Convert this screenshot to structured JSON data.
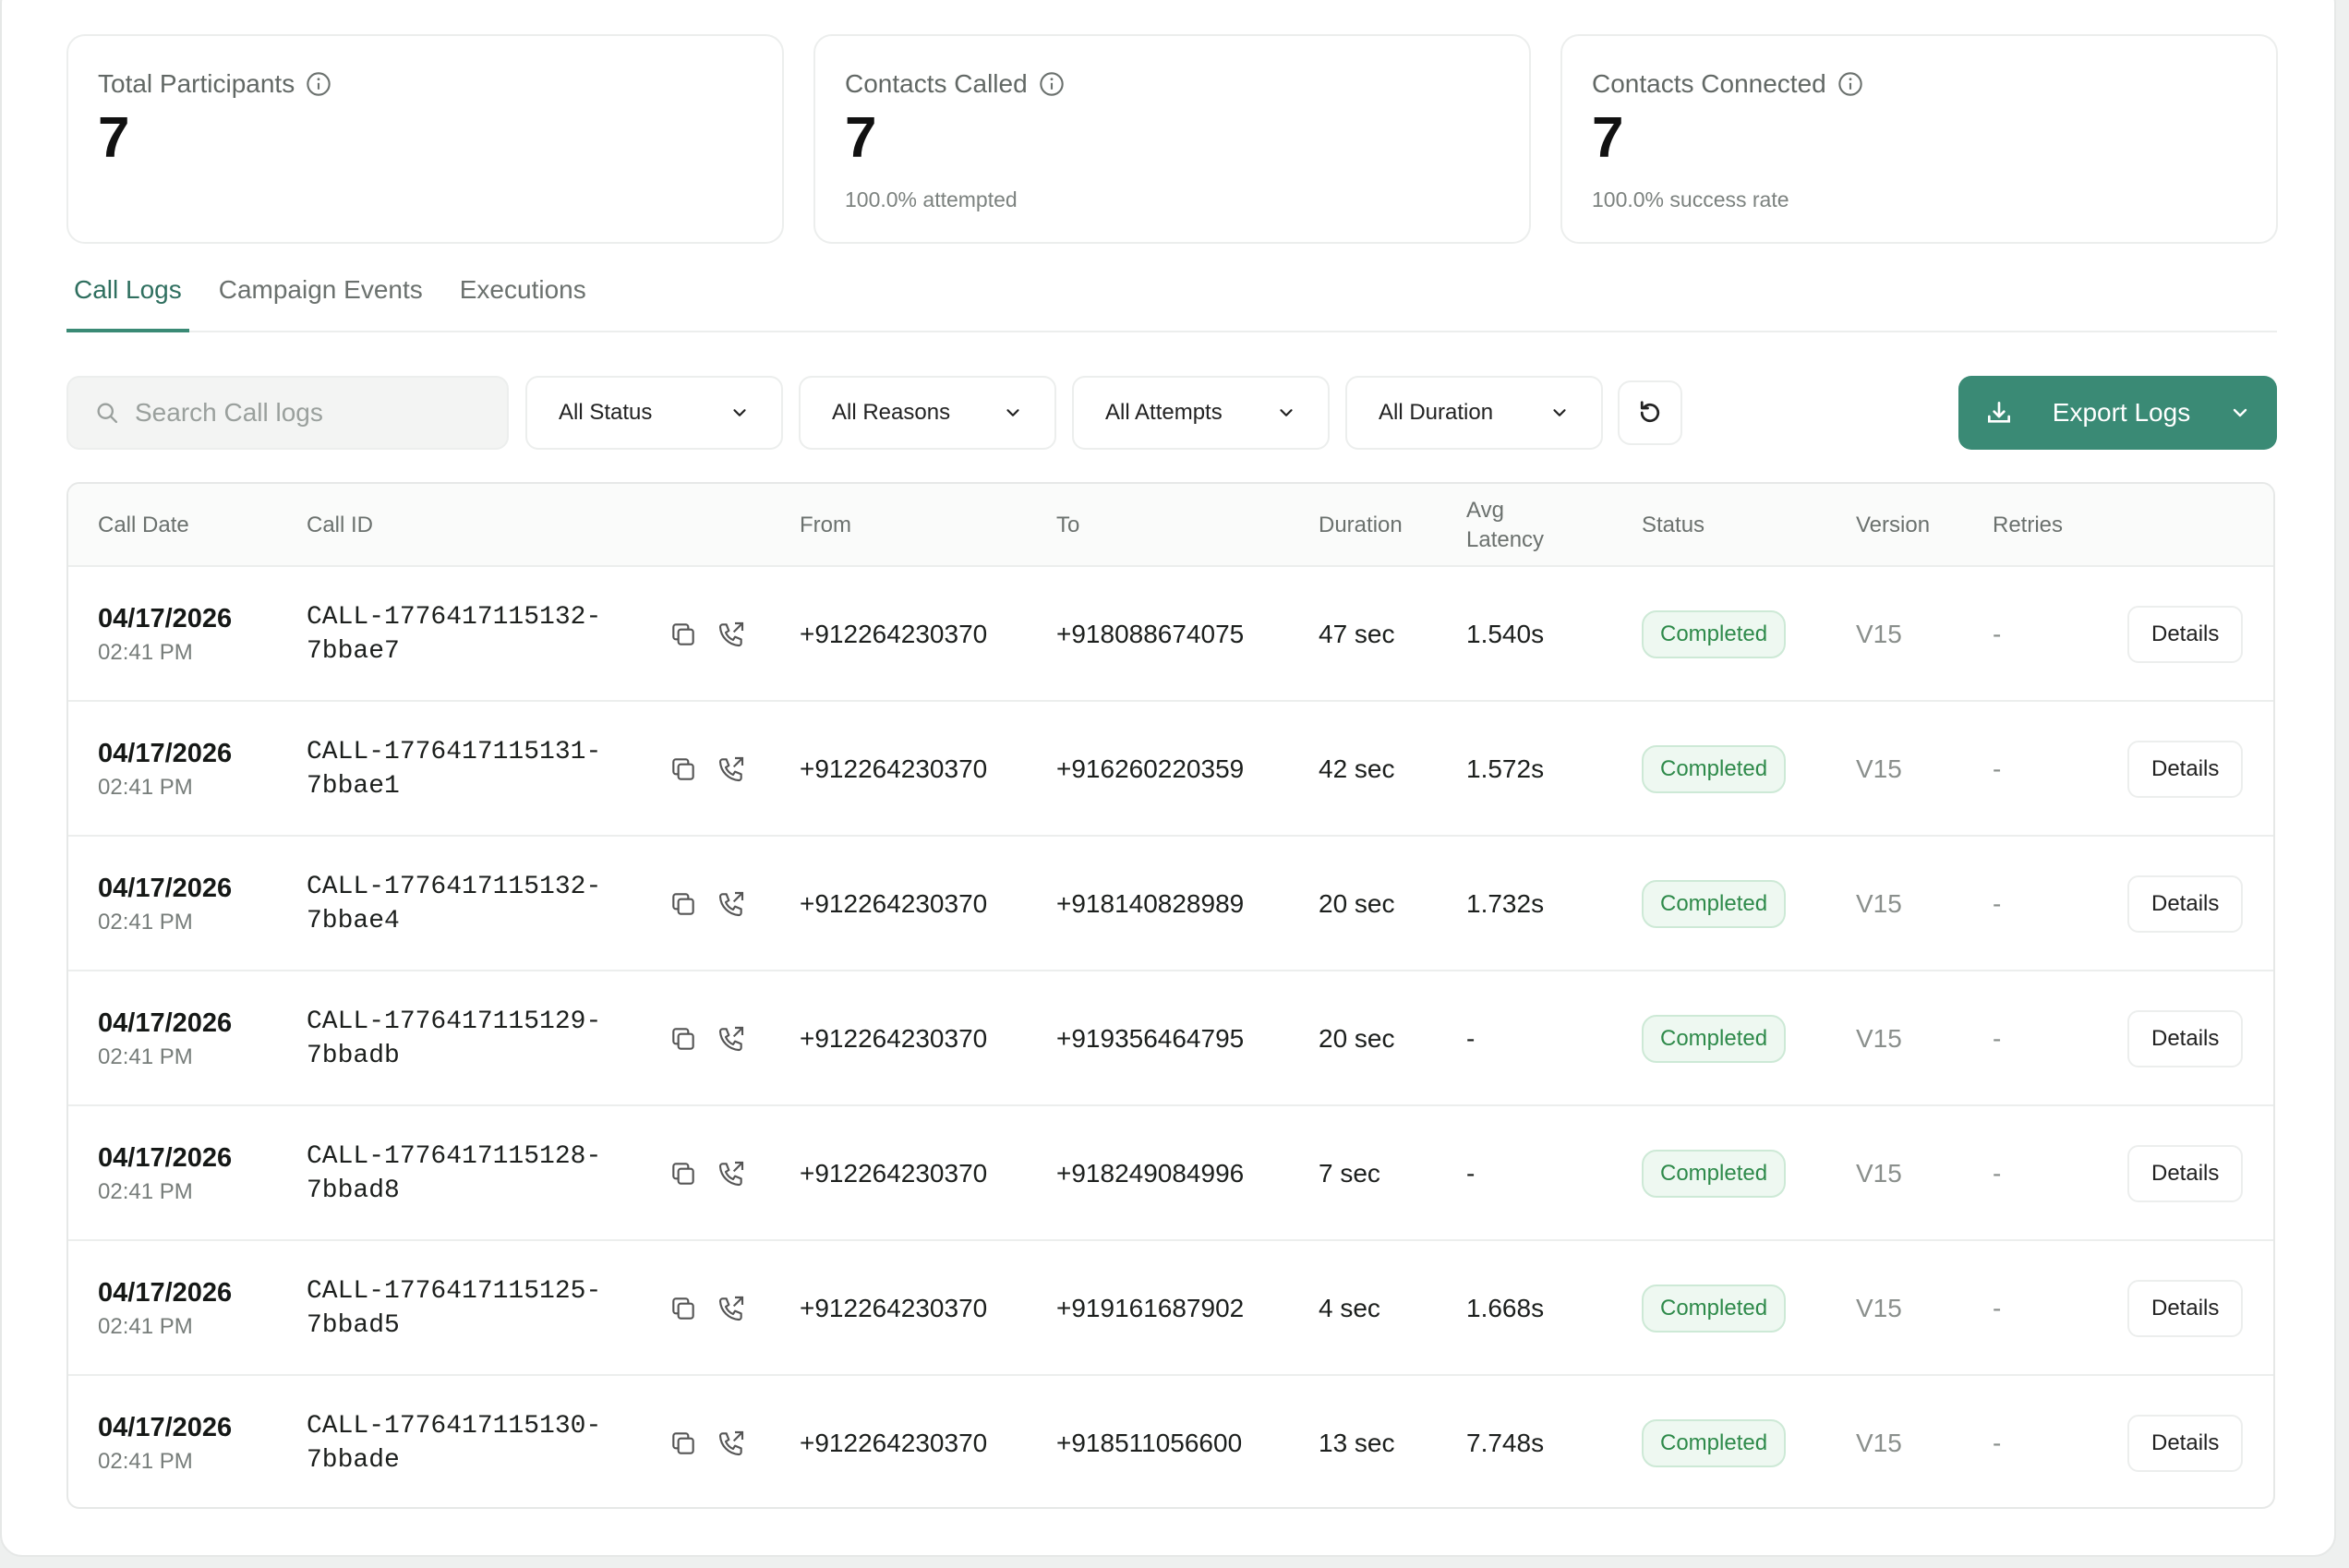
{
  "stats": [
    {
      "title": "Total Participants",
      "value": "7",
      "sub": ""
    },
    {
      "title": "Contacts Called",
      "value": "7",
      "sub": "100.0% attempted"
    },
    {
      "title": "Contacts Connected",
      "value": "7",
      "sub": "100.0% success rate"
    }
  ],
  "tabs": [
    "Call Logs",
    "Campaign Events",
    "Executions"
  ],
  "active_tab": "Call Logs",
  "toolbar": {
    "search_placeholder": "Search Call logs",
    "filters": [
      "All Status",
      "All Reasons",
      "All Attempts",
      "All Duration"
    ],
    "export_label": "Export Logs"
  },
  "table": {
    "headers": [
      "Call Date",
      "Call ID",
      "From",
      "To",
      "Duration",
      "Avg\nLatency",
      "Status",
      "Version",
      "Retries"
    ],
    "rows": [
      {
        "date": "04/17/2026",
        "time": "02:41 PM",
        "id1": "CALL-1776417115132-",
        "id2": "7bbae7",
        "from": "+912264230370",
        "to": "+918088674075",
        "duration": "47 sec",
        "latency": "1.540s",
        "status": "Completed",
        "version": "V15",
        "retries": "-",
        "action": "Details"
      },
      {
        "date": "04/17/2026",
        "time": "02:41 PM",
        "id1": "CALL-1776417115131-",
        "id2": "7bbae1",
        "from": "+912264230370",
        "to": "+916260220359",
        "duration": "42 sec",
        "latency": "1.572s",
        "status": "Completed",
        "version": "V15",
        "retries": "-",
        "action": "Details"
      },
      {
        "date": "04/17/2026",
        "time": "02:41 PM",
        "id1": "CALL-1776417115132-",
        "id2": "7bbae4",
        "from": "+912264230370",
        "to": "+918140828989",
        "duration": "20 sec",
        "latency": "1.732s",
        "status": "Completed",
        "version": "V15",
        "retries": "-",
        "action": "Details"
      },
      {
        "date": "04/17/2026",
        "time": "02:41 PM",
        "id1": "CALL-1776417115129-",
        "id2": "7bbadb",
        "from": "+912264230370",
        "to": "+919356464795",
        "duration": "20 sec",
        "latency": "-",
        "status": "Completed",
        "version": "V15",
        "retries": "-",
        "action": "Details"
      },
      {
        "date": "04/17/2026",
        "time": "02:41 PM",
        "id1": "CALL-1776417115128-",
        "id2": "7bbad8",
        "from": "+912264230370",
        "to": "+918249084996",
        "duration": "7 sec",
        "latency": "-",
        "status": "Completed",
        "version": "V15",
        "retries": "-",
        "action": "Details"
      },
      {
        "date": "04/17/2026",
        "time": "02:41 PM",
        "id1": "CALL-1776417115125-",
        "id2": "7bbad5",
        "from": "+912264230370",
        "to": "+919161687902",
        "duration": "4 sec",
        "latency": "1.668s",
        "status": "Completed",
        "version": "V15",
        "retries": "-",
        "action": "Details"
      },
      {
        "date": "04/17/2026",
        "time": "02:41 PM",
        "id1": "CALL-1776417115130-",
        "id2": "7bbade",
        "from": "+912264230370",
        "to": "+918511056600",
        "duration": "13 sec",
        "latency": "7.748s",
        "status": "Completed",
        "version": "V15",
        "retries": "-",
        "action": "Details"
      }
    ]
  },
  "colors": {
    "accent": "#3a8a75",
    "status_completed": "#2e8a4a"
  }
}
